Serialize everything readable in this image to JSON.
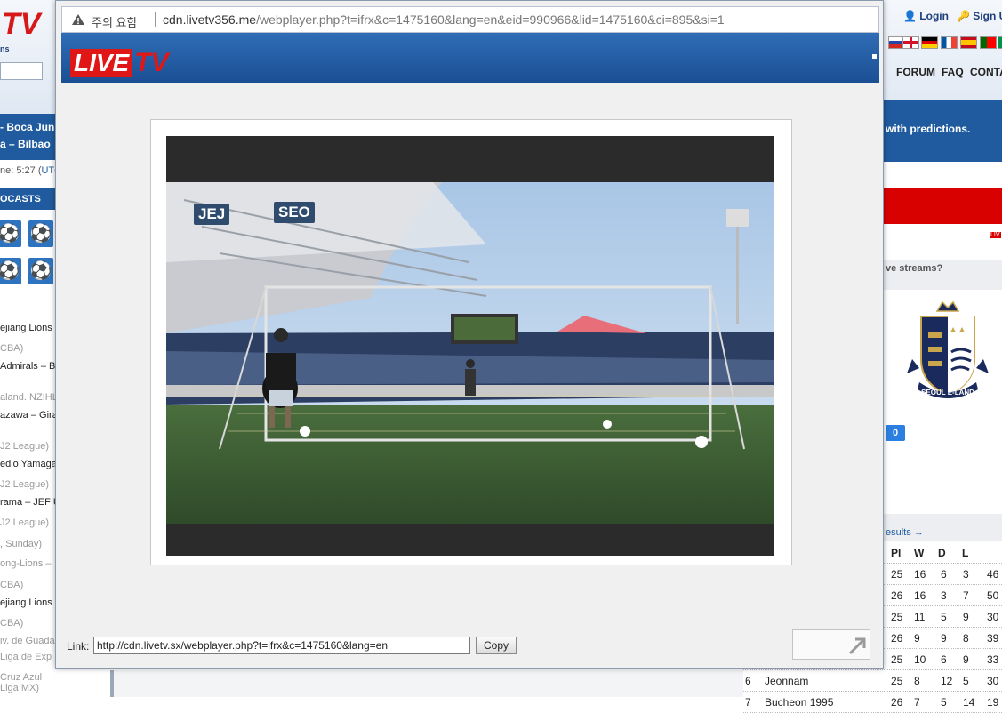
{
  "background": {
    "left_header": {
      "logo": "TV",
      "tagline": "ns"
    },
    "left_events": [
      "- Boca Juni",
      "a – Bilbao"
    ],
    "time_label": "ne: 5:27 (",
    "time_tz": "UTC",
    "broadcasts_label": "OCASTS",
    "left_list": [
      {
        "text": "ejiang Lions",
        "style": "b"
      },
      {
        "text": "CBA)",
        "style": "g"
      },
      {
        "text": "Admirals – Bo",
        "style": "b"
      },
      {
        "text": "aland. NZIHL",
        "style": "g"
      },
      {
        "text": "azawa – Gira",
        "style": "b"
      },
      {
        "text": "J2 League)",
        "style": "g"
      },
      {
        "text": "edio Yamaga",
        "style": "b"
      },
      {
        "text": "J2 League)",
        "style": "g"
      },
      {
        "text": "rama – JEF U",
        "style": "b"
      },
      {
        "text": "J2 League)",
        "style": "g"
      },
      {
        "text": ", Sunday)",
        "style": "g"
      },
      {
        "text": "ong-Lions –",
        "style": "g"
      },
      {
        "text": "CBA)",
        "style": "g"
      },
      {
        "text": "ejiang Lions",
        "style": "b"
      },
      {
        "text": "CBA)",
        "style": "g"
      },
      {
        "text": "iv. de Guada",
        "style": "g"
      },
      {
        "text": "Liga de Exp",
        "style": "g"
      },
      {
        "text": "Cruz Azul",
        "style": "g"
      },
      {
        "text": "Liga MX)",
        "style": "g"
      }
    ],
    "right_header": {
      "login": "Login",
      "signup": "Sign U",
      "nav": [
        "FORUM",
        "FAQ",
        "CONTA"
      ]
    },
    "predictions_text": "with predictions.",
    "streams_text": "ve streams?",
    "crest_text": "SEOUL E-LAND",
    "counter": "0",
    "results_link": "esults →",
    "table_header": [
      "Pl",
      "W",
      "D",
      "L"
    ],
    "table_rows": [
      {
        "pos": "",
        "team": "",
        "pl": "25",
        "w": "16",
        "d": "6",
        "l": "3",
        "pts": "46"
      },
      {
        "pos": "",
        "team": "",
        "pl": "26",
        "w": "16",
        "d": "3",
        "l": "7",
        "pts": "50"
      },
      {
        "pos": "",
        "team": "",
        "pl": "25",
        "w": "11",
        "d": "5",
        "l": "9",
        "pts": "30"
      },
      {
        "pos": "",
        "team": "",
        "pl": "26",
        "w": "9",
        "d": "9",
        "l": "8",
        "pts": "39"
      },
      {
        "pos": "",
        "team": "",
        "pl": "25",
        "w": "10",
        "d": "6",
        "l": "9",
        "pts": "33"
      },
      {
        "pos": "6",
        "team": "Jeonnam",
        "pl": "25",
        "w": "8",
        "d": "12",
        "l": "5",
        "pts": "30"
      },
      {
        "pos": "7",
        "team": "Bucheon 1995",
        "pl": "26",
        "w": "7",
        "d": "5",
        "l": "14",
        "pts": "19"
      }
    ]
  },
  "popup": {
    "warning_label": "주의 요함",
    "url_host": "cdn.livetv356.me",
    "url_path": "/webplayer.php?t=ifrx&c=1475160&lang=en&eid=990966&lid=1475160&ci=895&si=1",
    "logo_live": "LIVE",
    "logo_tv": "TV",
    "video": {
      "team_home": "JEJ",
      "team_away": "SEO"
    },
    "link_label": "Link:",
    "link_value": "http://cdn.livetv.sx/webplayer.php?t=ifrx&c=1475160&lang=en",
    "copy_label": "Copy"
  },
  "colors": {
    "brand_blue": "#1f5b9e",
    "brand_red": "#e01717",
    "player_bg": "#2b2b2b"
  }
}
